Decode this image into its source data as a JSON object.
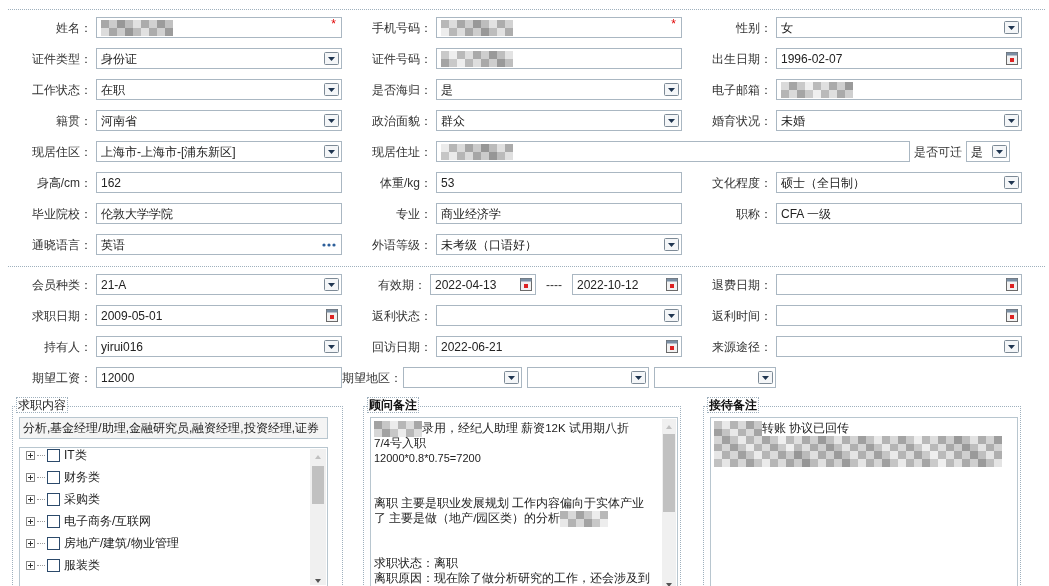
{
  "sections": [
    {
      "rows": [
        [
          {
            "label": "姓名：",
            "kind": "text",
            "redacted": true,
            "marker": "*"
          },
          {
            "label": "手机号码：",
            "kind": "text",
            "redacted": true,
            "marker": "*"
          },
          {
            "label": "性别：",
            "kind": "select",
            "value": "女"
          }
        ],
        [
          {
            "label": "证件类型：",
            "kind": "select",
            "value": "身份证"
          },
          {
            "label": "证件号码：",
            "kind": "text",
            "redacted": true
          },
          {
            "label": "出生日期：",
            "kind": "date",
            "value": "1996-02-07"
          }
        ],
        [
          {
            "label": "工作状态：",
            "kind": "select",
            "value": "在职"
          },
          {
            "label": "是否海归：",
            "kind": "select",
            "value": "是"
          },
          {
            "label": "电子邮箱：",
            "kind": "text",
            "redacted": true
          }
        ],
        [
          {
            "label": "籍贯：",
            "kind": "select",
            "value": "河南省"
          },
          {
            "label": "政治面貌：",
            "kind": "select",
            "value": "群众"
          },
          {
            "label": "婚育状况：",
            "kind": "select",
            "value": "未婚"
          }
        ],
        [
          {
            "label": "现居住区：",
            "kind": "select",
            "value": "上海市-上海市-[浦东新区]"
          },
          {
            "label": "现居住址：",
            "kind": "text",
            "redacted": true
          },
          {
            "label": "是否可迁",
            "kind": "inline_select",
            "value": "是"
          }
        ],
        [
          {
            "label": "身高/cm：",
            "kind": "text",
            "value": "162"
          },
          {
            "label": "体重/kg：",
            "kind": "text",
            "value": "53"
          },
          {
            "label": "文化程度：",
            "kind": "select",
            "value": "硕士（全日制）"
          }
        ],
        [
          {
            "label": "毕业院校：",
            "kind": "text",
            "value": "伦敦大学学院"
          },
          {
            "label": "专业：",
            "kind": "text",
            "value": "商业经济学"
          },
          {
            "label": "职称：",
            "kind": "text",
            "value": "CFA 一级"
          }
        ],
        [
          {
            "label": "通晓语言：",
            "kind": "lookup",
            "value": "英语"
          },
          {
            "label": "外语等级：",
            "kind": "select",
            "value": "未考级（口语好）"
          }
        ]
      ]
    },
    {
      "rows": [
        [
          {
            "label": "会员种类：",
            "kind": "select",
            "value": "21-A"
          },
          {
            "label": "有效期：",
            "kind": "date_range",
            "values": [
              "2022-04-13",
              "2022-10-12"
            ],
            "separator": "----"
          },
          {
            "label": "退费日期：",
            "kind": "date"
          }
        ],
        [
          {
            "label": "求职日期：",
            "kind": "date",
            "value": "2009-05-01"
          },
          {
            "label": "返利状态：",
            "kind": "select"
          },
          {
            "label": "返利时间：",
            "kind": "date"
          }
        ],
        [
          {
            "label": "持有人：",
            "kind": "select",
            "value": "yirui016"
          },
          {
            "label": "回访日期：",
            "kind": "date",
            "value": "2022-06-21"
          },
          {
            "label": "来源途径：",
            "kind": "select"
          }
        ],
        [
          {
            "label": "期望工资：",
            "kind": "text",
            "value": "12000"
          },
          {
            "label": "期望地区：",
            "kind": "multi_select"
          }
        ]
      ]
    }
  ],
  "panels": [
    {
      "kind": "tree",
      "legend": "求职内容",
      "value": "分析,基金经理/助理,金融研究员,融资经理,投资经理,证券",
      "items": [
        {
          "label": "IT类",
          "expanded": false,
          "checked": false
        },
        {
          "label": "财务类",
          "expanded": false,
          "checked": false
        },
        {
          "label": "采购类",
          "expanded": false,
          "checked": false
        },
        {
          "label": "电子商务/互联网",
          "expanded": false,
          "checked": false
        },
        {
          "label": "房地产/建筑/物业管理",
          "expanded": false,
          "checked": false
        },
        {
          "label": "服装类",
          "expanded": false,
          "checked": false
        }
      ]
    },
    {
      "kind": "notes",
      "legend": "顾问备注",
      "lines": [
        {
          "parts": [
            {
              "kind": "redacted"
            },
            {
              "kind": "text",
              "text": "录用，经纪人助理 薪资12K 试用期八折"
            }
          ]
        },
        {
          "parts": [
            {
              "kind": "text",
              "text": "7/4号入职"
            }
          ]
        },
        {
          "parts": [
            {
              "kind": "small",
              "text": "12000*0.8*0.75=7200"
            }
          ]
        },
        {
          "gap_before": true,
          "parts": [
            {
              "kind": "text",
              "text": "离职 主要是职业发展规划 工作内容偏向于实体产业"
            }
          ]
        },
        {
          "parts": [
            {
              "kind": "text",
              "text": "了 主要是做（地产/园区类）的分析 "
            },
            {
              "kind": "redacted"
            }
          ]
        },
        {
          "gap_before": true,
          "parts": [
            {
              "kind": "text",
              "text": "求职状态：离职"
            }
          ]
        },
        {
          "parts": [
            {
              "kind": "text",
              "text": "离职原因：现在除了做分析研究的工作，还会涉及到"
            }
          ]
        }
      ]
    },
    {
      "kind": "notes",
      "legend": "接待备注",
      "lines": [
        {
          "parts": [
            {
              "kind": "redacted"
            },
            {
              "kind": "text",
              "text": " 转账 协议已回传"
            }
          ]
        },
        {
          "parts": [
            {
              "kind": "redacted"
            }
          ]
        },
        {
          "parts": [
            {
              "kind": "redacted"
            }
          ]
        }
      ]
    }
  ]
}
